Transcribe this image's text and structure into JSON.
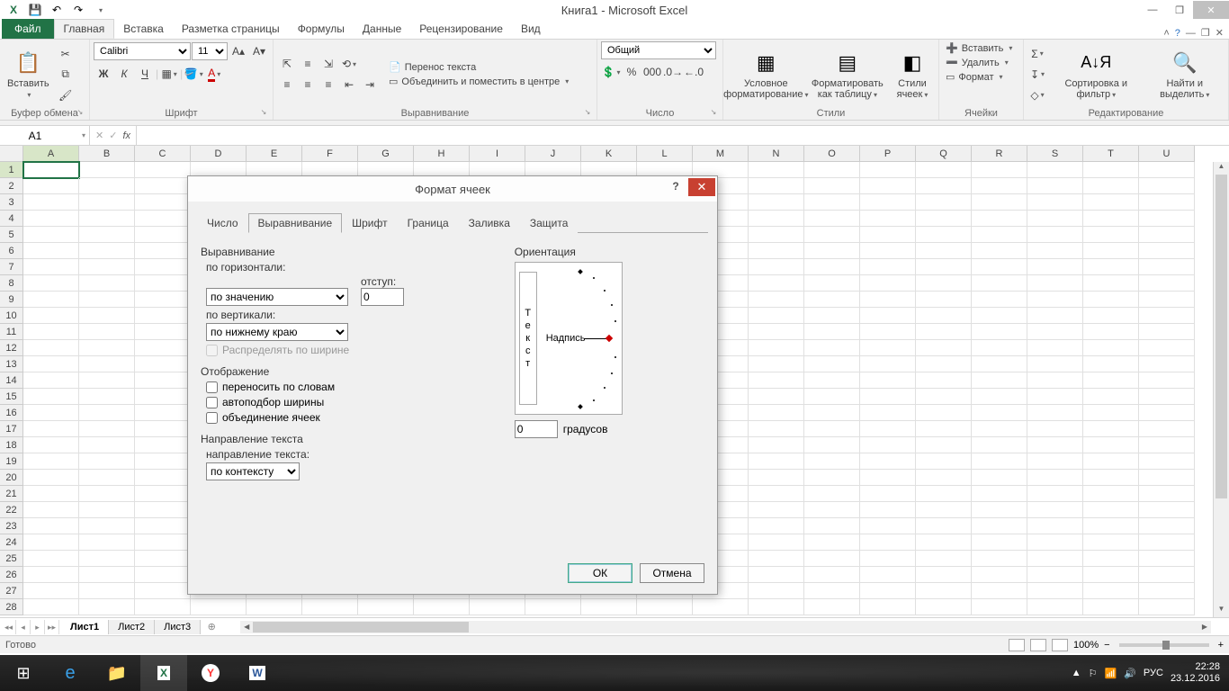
{
  "title": "Книга1 - Microsoft Excel",
  "qat": {
    "save": "💾",
    "undo": "↶",
    "redo": "↷"
  },
  "ribbon_tabs": {
    "file": "Файл",
    "items": [
      "Главная",
      "Вставка",
      "Разметка страницы",
      "Формулы",
      "Данные",
      "Рецензирование",
      "Вид"
    ],
    "active": 0
  },
  "groups": {
    "clipboard": {
      "paste": "Вставить",
      "label": "Буфер обмена"
    },
    "font": {
      "name": "Calibri",
      "size": "11",
      "label": "Шрифт",
      "bold": "Ж",
      "italic": "К",
      "underline": "Ч"
    },
    "alignment": {
      "wrap": "Перенос текста",
      "merge": "Объединить и поместить в центре",
      "label": "Выравнивание"
    },
    "number": {
      "format": "Общий",
      "label": "Число"
    },
    "styles": {
      "cond": "Условное форматирование",
      "table": "Форматировать как таблицу",
      "cell": "Стили ячеек",
      "label": "Стили"
    },
    "cells": {
      "insert": "Вставить",
      "delete": "Удалить",
      "format": "Формат",
      "label": "Ячейки"
    },
    "editing": {
      "sort": "Сортировка и фильтр",
      "find": "Найти и выделить",
      "label": "Редактирование"
    }
  },
  "formula_bar": {
    "name_box": "A1",
    "fx": "fx"
  },
  "columns": [
    "A",
    "B",
    "C",
    "D",
    "E",
    "F",
    "G",
    "H",
    "I",
    "J",
    "K",
    "L",
    "M",
    "N",
    "O",
    "P",
    "Q",
    "R",
    "S",
    "T",
    "U"
  ],
  "rows": 28,
  "sheets": {
    "items": [
      "Лист1",
      "Лист2",
      "Лист3"
    ],
    "active": 0
  },
  "status": {
    "ready": "Готово",
    "zoom": "100%"
  },
  "dialog": {
    "title": "Формат ячеек",
    "tabs": [
      "Число",
      "Выравнивание",
      "Шрифт",
      "Граница",
      "Заливка",
      "Защита"
    ],
    "active_tab": 1,
    "alignment": {
      "section": "Выравнивание",
      "horiz_label": "по горизонтали:",
      "horiz_value": "по значению",
      "indent_label": "отступ:",
      "indent_value": "0",
      "vert_label": "по вертикали:",
      "vert_value": "по нижнему краю",
      "distribute": "Распределять по ширине",
      "display_section": "Отображение",
      "wrap": "переносить по словам",
      "shrink": "автоподбор ширины",
      "merge": "объединение ячеек",
      "direction_section": "Направление текста",
      "direction_label": "направление текста:",
      "direction_value": "по контексту",
      "orient_section": "Ориентация",
      "orient_vert": "Текст",
      "orient_label": "Надпись",
      "degrees_value": "0",
      "degrees_label": "градусов"
    },
    "ok": "ОК",
    "cancel": "Отмена"
  },
  "taskbar": {
    "time": "22:28",
    "date": "23.12.2016",
    "lang": "РУС"
  }
}
